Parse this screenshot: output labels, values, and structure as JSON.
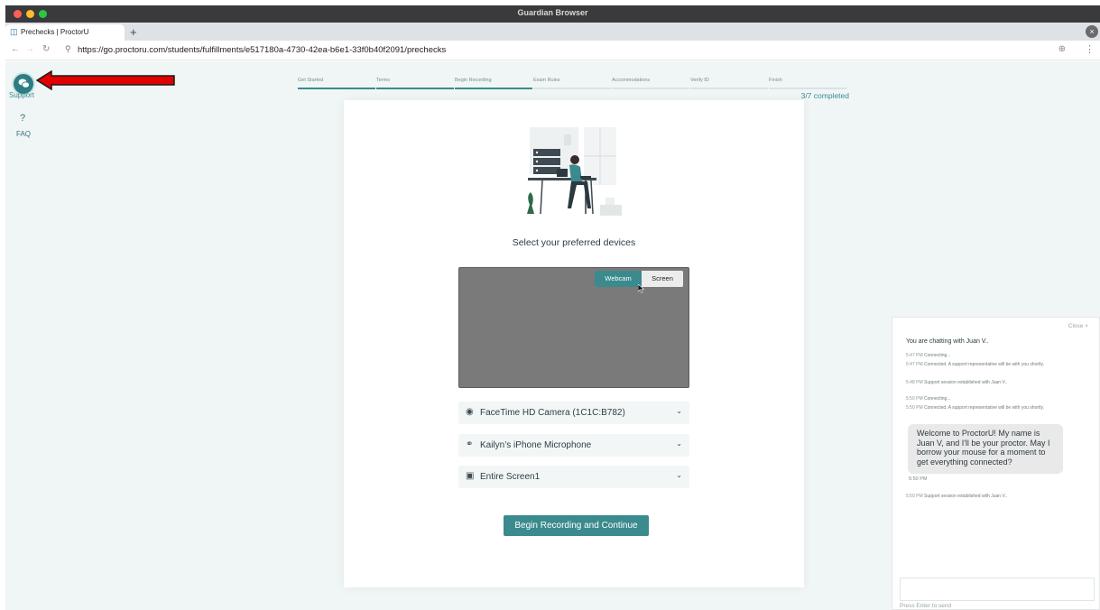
{
  "window": {
    "title": "Guardian Browser"
  },
  "tab": {
    "label": "Prechecks | ProctorU",
    "new_tab": "+"
  },
  "address_bar": {
    "url": "https://go.proctoru.com/students/fulfillments/e517180a-4730-42ea-b6e1-33f0b40f2091/prechecks"
  },
  "sidebar": {
    "support_label": "Support",
    "faq_label": "FAQ",
    "faq_glyph": "?"
  },
  "stepper": {
    "steps": [
      "Get Started",
      "Terms",
      "Begin Recording",
      "Exam Rules",
      "Accommodations",
      "Verify ID",
      "Finish"
    ],
    "completed_steps": 3,
    "total_steps": 7,
    "progress_text": "3/7 completed"
  },
  "card": {
    "heading": "Select your preferred devices",
    "toggle": {
      "webcam": "Webcam",
      "screen": "Screen",
      "selected": "Webcam"
    },
    "devices": {
      "camera": "FaceTime HD Camera (1C1C:B782)",
      "microphone": "Kailyn’s iPhone Microphone",
      "screen": "Entire Screen1"
    },
    "begin_button": "Begin Recording and Continue"
  },
  "chat": {
    "close_label": "Close ×",
    "header": "You are chatting with Juan V..",
    "messages": [
      {
        "time": "5:47 PM",
        "text": "Connecting..."
      },
      {
        "time": "5:47 PM",
        "text": "Connected. A support representative will be with you shortly."
      },
      {
        "time": "5:48 PM",
        "text": "Support session established with Juan V.."
      },
      {
        "time": "5:50 PM",
        "text": "Connecting..."
      },
      {
        "time": "5:50 PM",
        "text": "Connected. A support representative will be with you shortly."
      }
    ],
    "bubble": {
      "text": "Welcome to ProctorU! My name is Juan V, and I'll be your proctor. May I borrow your mouse for a moment to get everything connected?",
      "time": "5:50 PM"
    },
    "after_bubble": {
      "time": "5:50 PM",
      "text": "Support session established with Juan V.."
    },
    "input_hint": "Press Enter to send"
  },
  "colors": {
    "accent": "#3a8a8e",
    "page_bg": "#f0f6f6",
    "arrow": "#e00000"
  }
}
